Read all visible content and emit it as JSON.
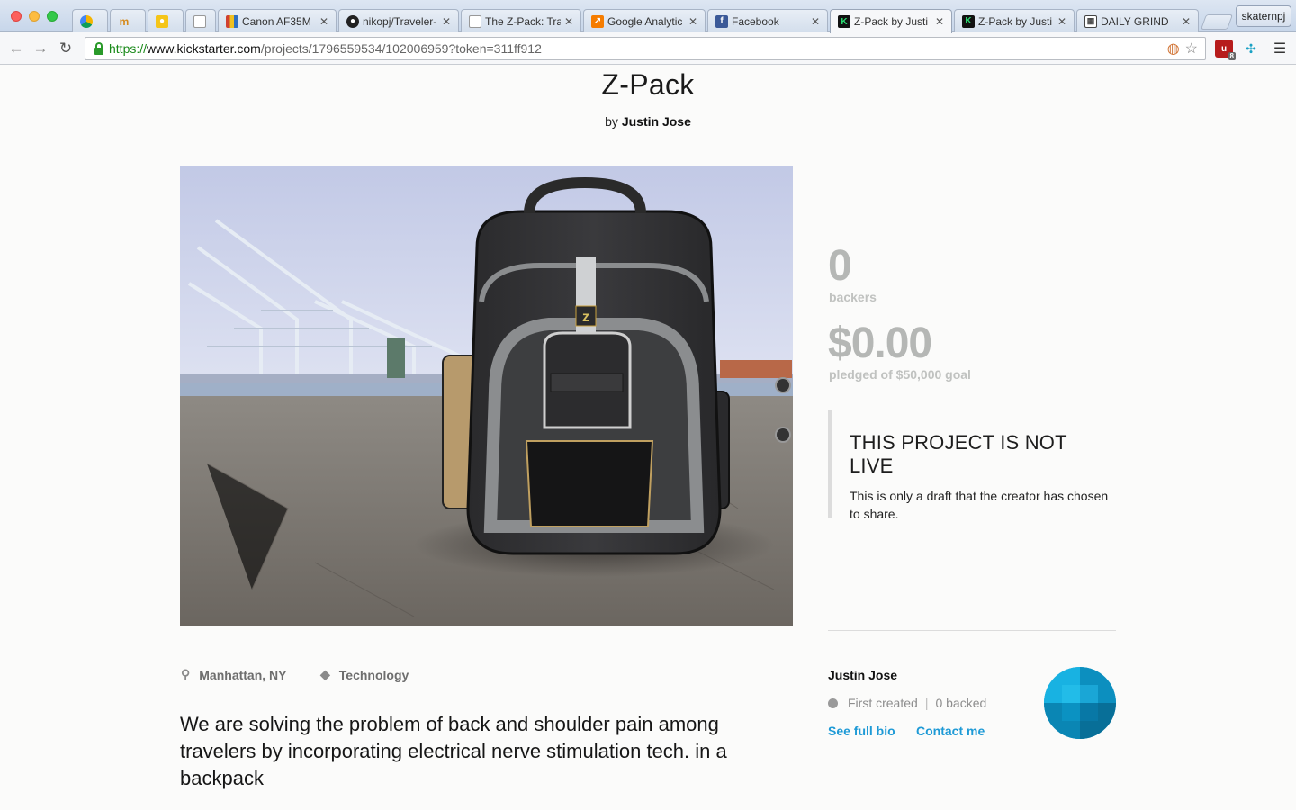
{
  "browser": {
    "tabs": [
      {
        "title": "",
        "favicon": "drive-icon",
        "color": "#f4b400"
      },
      {
        "title": "",
        "favicon": "m-icon",
        "color": "#e8a33c"
      },
      {
        "title": "",
        "favicon": "bulb-icon",
        "color": "#f5c518"
      },
      {
        "title": "",
        "favicon": "page-icon",
        "color": "#ffffff"
      },
      {
        "title": "Canon AF35M",
        "favicon": "camera-icon",
        "color": "#d04030"
      },
      {
        "title": "nikopj/Traveler-",
        "favicon": "github-icon",
        "color": "#222222"
      },
      {
        "title": "The Z-Pack: Tra",
        "favicon": "page-icon",
        "color": "#ffffff"
      },
      {
        "title": "Google Analytic",
        "favicon": "analytics-icon",
        "color": "#f57c00"
      },
      {
        "title": "Facebook",
        "favicon": "facebook-icon",
        "color": "#3b5998"
      },
      {
        "title": "Z-Pack by Justi",
        "favicon": "kickstarter-icon",
        "color": "#111111"
      },
      {
        "title": "Z-Pack by Justi",
        "favicon": "kickstarter-icon",
        "color": "#111111"
      },
      {
        "title": "DAILY GRIND",
        "favicon": "grid-icon",
        "color": "#444444"
      }
    ],
    "profile_name": "skaternpj",
    "url": {
      "scheme": "https://",
      "host": "www.kickstarter.com",
      "path": "/projects/1796559534/102006959?token=311ff912"
    },
    "ublock_count": "8"
  },
  "project": {
    "title": "Z-Pack",
    "by_prefix": "by",
    "creator": "Justin Jose",
    "backers_count": "0",
    "backers_label": "backers",
    "pledged_amount": "$0.00",
    "pledged_label": "pledged of $50,000 goal",
    "not_live_heading": "THIS PROJECT IS NOT LIVE",
    "not_live_text": "This is only a draft that the creator has chosen to share.",
    "location": "Manhattan, NY",
    "category": "Technology",
    "blurb": "We are solving the problem of back and shoulder pain among travelers by incorporating electrical nerve stimulation tech. in a backpack"
  },
  "creator_card": {
    "name": "Justin Jose",
    "first_created": "First created",
    "backed": "0 backed",
    "see_bio": "See full bio",
    "contact": "Contact me"
  },
  "colors": {
    "accent_link": "#1e9ad6",
    "stat_gray": "#b5b7b5",
    "avatar_blue": "#0e9fd0"
  }
}
